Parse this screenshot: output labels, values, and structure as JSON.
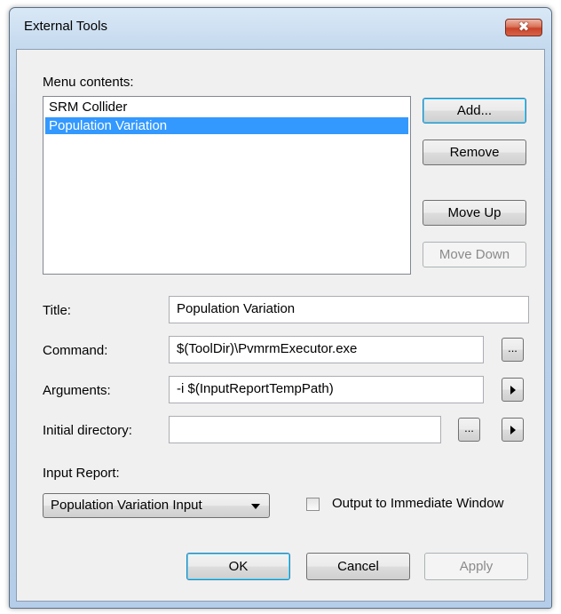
{
  "window": {
    "title": "External Tools",
    "close_glyph": "✖"
  },
  "menu_contents": {
    "label": "Menu contents:",
    "items": [
      {
        "label": "SRM Collider",
        "selected": false
      },
      {
        "label": "Population Variation",
        "selected": true
      }
    ]
  },
  "side_buttons": {
    "add": "Add...",
    "remove": "Remove",
    "move_up": "Move Up",
    "move_down": "Move Down"
  },
  "fields": {
    "title_label": "Title:",
    "title_value": "Population Variation",
    "command_label": "Command:",
    "command_value": "$(ToolDir)\\PvmrmExecutor.exe",
    "arguments_label": "Arguments:",
    "arguments_value": "-i $(InputReportTempPath)",
    "initial_dir_label": "Initial directory:",
    "initial_dir_value": "",
    "browse_glyph": "...",
    "arrow_icon": "right-triangle-icon"
  },
  "input_report": {
    "label": "Input Report:",
    "selected": "Population Variation Input"
  },
  "output_immediate": {
    "label": "Output to Immediate Window",
    "checked": false
  },
  "footer": {
    "ok": "OK",
    "cancel": "Cancel",
    "apply": "Apply"
  },
  "colors": {
    "selection": "#3399ff",
    "close_button": "#c9442a",
    "frame": "#bcd2ea"
  }
}
